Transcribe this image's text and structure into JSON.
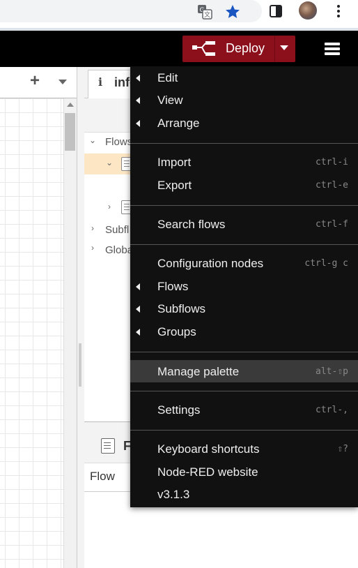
{
  "header": {
    "deploy_label": "Deploy"
  },
  "workspace": {
    "add_tab": "+"
  },
  "sidebar": {
    "info_tab_icon": "i",
    "info_tab_label": "info",
    "tree": {
      "flows": "Flows",
      "subflows": "Subfl",
      "globals": "Globa"
    },
    "help_title": "F",
    "help_flow": "Flow"
  },
  "menu": {
    "items": [
      {
        "label": "Edit",
        "shortcut": "",
        "submenu": true
      },
      {
        "label": "View",
        "shortcut": "",
        "submenu": true
      },
      {
        "label": "Arrange",
        "shortcut": "",
        "submenu": true
      },
      {
        "label": "Import",
        "shortcut": "ctrl-i",
        "submenu": false
      },
      {
        "label": "Export",
        "shortcut": "ctrl-e",
        "submenu": false
      },
      {
        "label": "Search flows",
        "shortcut": "ctrl-f",
        "submenu": false
      },
      {
        "label": "Configuration nodes",
        "shortcut": "ctrl-g c",
        "submenu": false
      },
      {
        "label": "Flows",
        "shortcut": "",
        "submenu": true
      },
      {
        "label": "Subflows",
        "shortcut": "",
        "submenu": true
      },
      {
        "label": "Groups",
        "shortcut": "",
        "submenu": true
      },
      {
        "label": "Manage palette",
        "shortcut": "alt-⇧p",
        "submenu": false,
        "highlighted": true
      },
      {
        "label": "Settings",
        "shortcut": "ctrl-,",
        "submenu": false
      },
      {
        "label": "Keyboard shortcuts",
        "shortcut": "⇧?",
        "submenu": false
      },
      {
        "label": "Node-RED website",
        "shortcut": "",
        "submenu": false
      },
      {
        "label": "v3.1.3",
        "shortcut": "",
        "submenu": false
      }
    ]
  },
  "colors": {
    "deploy_red": "#8c101c",
    "header_black": "#000000",
    "menu_bg": "#111111",
    "selected_flow_bg": "#fce6c4"
  }
}
